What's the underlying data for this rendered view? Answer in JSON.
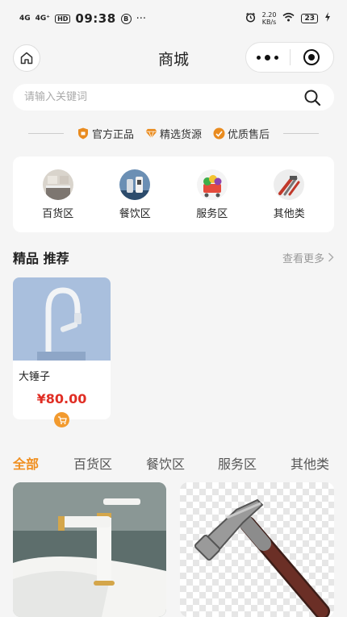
{
  "status_bar": {
    "signal_1": "4G",
    "signal_2": "4G⁺",
    "hd": "HD",
    "time": "09:38",
    "extra_icon": "Ⓑ",
    "more": "···",
    "net_speed_value": "2.20",
    "net_speed_unit": "KB/s",
    "battery": "23"
  },
  "nav": {
    "title": "商城"
  },
  "search": {
    "placeholder": "请输入关键词",
    "value": ""
  },
  "guarantees": [
    {
      "label": "官方正品",
      "icon": "shield-icon"
    },
    {
      "label": "精选货源",
      "icon": "diamond-icon"
    },
    {
      "label": "优质售后",
      "icon": "service-icon"
    }
  ],
  "categories": [
    {
      "label": "百货区",
      "icon": "kitchen-image"
    },
    {
      "label": "餐饮区",
      "icon": "appliance-image"
    },
    {
      "label": "服务区",
      "icon": "shopping-cart-image"
    },
    {
      "label": "其他类",
      "icon": "tools-image"
    }
  ],
  "recommend": {
    "title": "精品 推荐",
    "more_label": "查看更多",
    "items": [
      {
        "name": "大锤子",
        "price": "¥80.00"
      }
    ]
  },
  "tabs": [
    {
      "label": "全部",
      "active": true
    },
    {
      "label": "百货区",
      "active": false
    },
    {
      "label": "餐饮区",
      "active": false
    },
    {
      "label": "服务区",
      "active": false
    },
    {
      "label": "其他类",
      "active": false
    }
  ],
  "colors": {
    "accent": "#f08e1e",
    "price": "#e02e24",
    "background": "#f5f5f5"
  }
}
